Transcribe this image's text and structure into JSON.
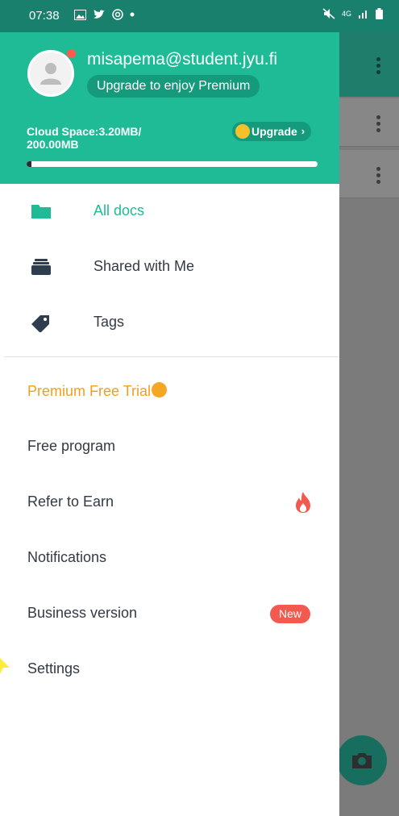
{
  "status_bar": {
    "time": "07:38",
    "left_icons": [
      "gallery-icon",
      "twitter-icon",
      "at-icon",
      "dot-icon"
    ],
    "right_icons": [
      "mute-icon",
      "network-4g-icon",
      "signal-icon",
      "battery-icon"
    ],
    "network_label": "4G"
  },
  "drawer": {
    "header": {
      "email": "misapema@student.jyu.fi",
      "premium_prompt": "Upgrade to enjoy Premium",
      "cloud_space_label": "Cloud Space:3.20MB/ 200.00MB",
      "upgrade_label": "Upgrade",
      "upgrade_chevron": "›",
      "storage_used_fraction": 0.016
    },
    "nav": [
      {
        "label": "All docs",
        "icon": "folder-icon",
        "active": true
      },
      {
        "label": "Shared with Me",
        "icon": "shared-stack-icon",
        "active": false
      },
      {
        "label": "Tags",
        "icon": "tag-icon",
        "active": false
      }
    ],
    "menu": [
      {
        "label": "Premium Free Trial"
      },
      {
        "label": "Free program"
      },
      {
        "label": "Refer to Earn"
      },
      {
        "label": "Notifications"
      },
      {
        "label": "Business version",
        "badge": "New"
      },
      {
        "label": "Settings"
      }
    ]
  },
  "colors": {
    "accent": "#1ebb96",
    "status_bar": "#1a806e",
    "premium": "#f0a020",
    "badge": "#f25a4f"
  }
}
